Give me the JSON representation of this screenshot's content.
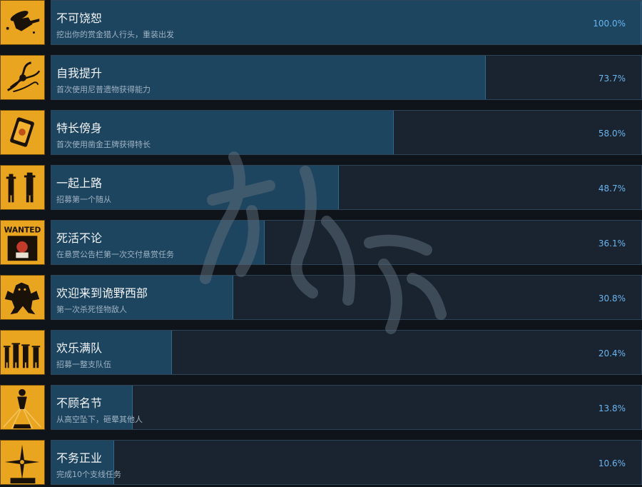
{
  "colors": {
    "background": "#0f131a",
    "panel": "#1a2330",
    "progress_fill": "#1d4560",
    "percent_text": "#6ab6f0",
    "icon_background": "#e9a520"
  },
  "achievements": [
    {
      "icon": "shooting-cowboy-icon",
      "title": "不可饶恕",
      "description": "挖出你的赏金猎人行头，重装出发",
      "percent_text": "100.0%",
      "percent": 100.0
    },
    {
      "icon": "relic-tentacle-icon",
      "title": "自我提升",
      "description": "首次使用尼普遗物获得能力",
      "percent_text": "73.7%",
      "percent": 73.7
    },
    {
      "icon": "golden-card-icon",
      "title": "特长傍身",
      "description": "首次使用凿金王牌获得特长",
      "percent_text": "58.0%",
      "percent": 58.0
    },
    {
      "icon": "two-cowboys-icon",
      "title": "一起上路",
      "description": "招募第一个随从",
      "percent_text": "48.7%",
      "percent": 48.7
    },
    {
      "icon": "wanted-poster-icon",
      "title": "死活不论",
      "description": "在悬赏公告栏第一次交付悬赏任务",
      "percent_text": "36.1%",
      "percent": 36.1,
      "icon_text": "WANTED"
    },
    {
      "icon": "monster-icon",
      "title": "欢迎来到诡野西部",
      "description": "第一次杀死怪物敌人",
      "percent_text": "30.8%",
      "percent": 30.8
    },
    {
      "icon": "posse-icon",
      "title": "欢乐满队",
      "description": "招募一整支队伍",
      "percent_text": "20.4%",
      "percent": 20.4
    },
    {
      "icon": "falling-figure-icon",
      "title": "不顾名节",
      "description": "从高空坠下，砸晕其他人",
      "percent_text": "13.8%",
      "percent": 13.8
    },
    {
      "icon": "compass-star-icon",
      "title": "不务正业",
      "description": "完成10个支线任务",
      "percent_text": "10.6%",
      "percent": 10.6
    }
  ]
}
